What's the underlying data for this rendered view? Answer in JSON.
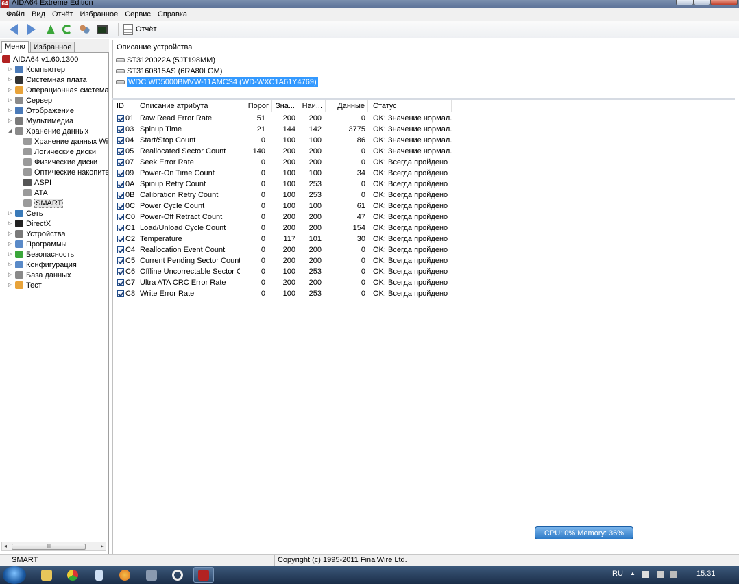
{
  "window": {
    "title": "AIDA64 Extreme Edition",
    "icon_label": "64"
  },
  "menu": [
    "Файл",
    "Вид",
    "Отчёт",
    "Избранное",
    "Сервис",
    "Справка"
  ],
  "toolbar": {
    "report_label": "Отчёт"
  },
  "left_tabs": [
    "Меню",
    "Избранное"
  ],
  "tree": [
    {
      "label": "AIDA64 v1.60.1300",
      "icon": "aida-icon",
      "color": "#b22222"
    },
    {
      "label": "Компьютер",
      "icon": "computer-icon",
      "color": "#4a7ab8"
    },
    {
      "label": "Системная плата",
      "icon": "motherboard-icon",
      "color": "#333333"
    },
    {
      "label": "Операционная система",
      "icon": "windows-icon",
      "color": "#e8a33a"
    },
    {
      "label": "Сервер",
      "icon": "server-icon",
      "color": "#8a8a8a"
    },
    {
      "label": "Отображение",
      "icon": "display-icon",
      "color": "#4a7ab8"
    },
    {
      "label": "Мультимедиа",
      "icon": "multimedia-icon",
      "color": "#7a7a7a"
    },
    {
      "label": "Хранение данных",
      "icon": "storage-icon",
      "color": "#8a8a8a"
    },
    {
      "label": "Хранение данных Win",
      "icon": "storage-win-icon",
      "color": "#9a9a9a"
    },
    {
      "label": "Логические диски",
      "icon": "logical-disk-icon",
      "color": "#9a9a9a"
    },
    {
      "label": "Физические диски",
      "icon": "physical-disk-icon",
      "color": "#9a9a9a"
    },
    {
      "label": "Оптические накопите",
      "icon": "optical-drive-icon",
      "color": "#9a9a9a"
    },
    {
      "label": "ASPI",
      "icon": "aspi-icon",
      "color": "#555555"
    },
    {
      "label": "ATA",
      "icon": "ata-icon",
      "color": "#9a9a9a"
    },
    {
      "label": "SMART",
      "icon": "smart-icon",
      "color": "#9a9a9a"
    },
    {
      "label": "Сеть",
      "icon": "network-icon",
      "color": "#3a7ab8"
    },
    {
      "label": "DirectX",
      "icon": "directx-icon",
      "color": "#222222"
    },
    {
      "label": "Устройства",
      "icon": "devices-icon",
      "color": "#7a7a7a"
    },
    {
      "label": "Программы",
      "icon": "programs-icon",
      "color": "#5a8ac8"
    },
    {
      "label": "Безопасность",
      "icon": "security-icon",
      "color": "#3aa63a"
    },
    {
      "label": "Конфигурация",
      "icon": "config-icon",
      "color": "#5a8ac8"
    },
    {
      "label": "База данных",
      "icon": "database-icon",
      "color": "#8a8a8a"
    },
    {
      "label": "Тест",
      "icon": "test-icon",
      "color": "#e8a33a"
    }
  ],
  "devices": {
    "header": "Описание устройства",
    "items": [
      "ST3120022A (5JT198MM)",
      "ST3160815AS (6RA80LGM)",
      "WDC WD5000BMVW-11AMCS4 (WD-WXC1A61Y4769)"
    ],
    "selected": 2
  },
  "attributes": {
    "headers": [
      "ID",
      "Описание атрибута",
      "Порог",
      "Зна...",
      "Наи...",
      "Данные",
      "Статус"
    ],
    "rows": [
      [
        "01",
        "Raw Read Error Rate",
        "51",
        "200",
        "200",
        "0",
        "OK: Значение нормал..."
      ],
      [
        "03",
        "Spinup Time",
        "21",
        "144",
        "142",
        "3775",
        "OK: Значение нормал..."
      ],
      [
        "04",
        "Start/Stop Count",
        "0",
        "100",
        "100",
        "86",
        "OK: Значение нормал..."
      ],
      [
        "05",
        "Reallocated Sector Count",
        "140",
        "200",
        "200",
        "0",
        "OK: Значение нормал..."
      ],
      [
        "07",
        "Seek Error Rate",
        "0",
        "200",
        "200",
        "0",
        "OK: Всегда пройдено"
      ],
      [
        "09",
        "Power-On Time Count",
        "0",
        "100",
        "100",
        "34",
        "OK: Всегда пройдено"
      ],
      [
        "0A",
        "Spinup Retry Count",
        "0",
        "100",
        "253",
        "0",
        "OK: Всегда пройдено"
      ],
      [
        "0B",
        "Calibration Retry Count",
        "0",
        "100",
        "253",
        "0",
        "OK: Всегда пройдено"
      ],
      [
        "0C",
        "Power Cycle Count",
        "0",
        "100",
        "100",
        "61",
        "OK: Всегда пройдено"
      ],
      [
        "C0",
        "Power-Off Retract Count",
        "0",
        "200",
        "200",
        "47",
        "OK: Всегда пройдено"
      ],
      [
        "C1",
        "Load/Unload Cycle Count",
        "0",
        "200",
        "200",
        "154",
        "OK: Всегда пройдено"
      ],
      [
        "C2",
        "Temperature",
        "0",
        "117",
        "101",
        "30",
        "OK: Всегда пройдено"
      ],
      [
        "C4",
        "Reallocation Event Count",
        "0",
        "200",
        "200",
        "0",
        "OK: Всегда пройдено"
      ],
      [
        "C5",
        "Current Pending Sector Count",
        "0",
        "200",
        "200",
        "0",
        "OK: Всегда пройдено"
      ],
      [
        "C6",
        "Offline Uncorrectable Sector C...",
        "0",
        "100",
        "253",
        "0",
        "OK: Всегда пройдено"
      ],
      [
        "C7",
        "Ultra ATA CRC Error Rate",
        "0",
        "200",
        "200",
        "0",
        "OK: Всегда пройдено"
      ],
      [
        "C8",
        "Write Error Rate",
        "0",
        "100",
        "253",
        "0",
        "OK: Всегда пройдено"
      ]
    ]
  },
  "cpu_memory": "CPU: 0%   Memory: 36%",
  "status": {
    "left": "SMART",
    "right": "Copyright (c) 1995-2011 FinalWire Ltd."
  },
  "taskbar": {
    "lang": "RU",
    "time": "15:31"
  }
}
